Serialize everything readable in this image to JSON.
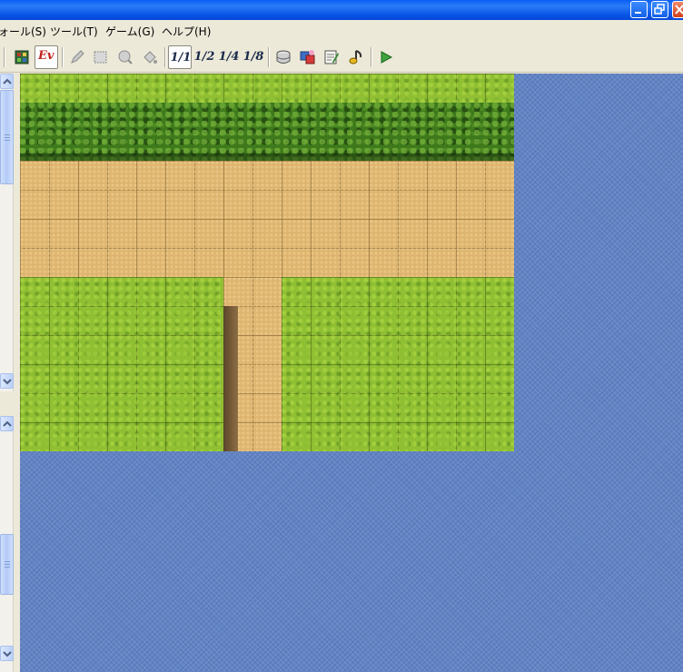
{
  "window": {
    "controls": {
      "minimize_icon": "minimize-icon",
      "maximize_icon": "restore-icon",
      "close_icon": "close-icon"
    }
  },
  "menu": {
    "items": [
      "ォール(S)",
      "ツール(T)",
      "ゲーム(G)",
      "ヘルプ(H)"
    ]
  },
  "toolbar": {
    "icons": [
      "tile-layer-icon",
      "event-layer-icon",
      "pencil-icon",
      "rectangle-icon",
      "ellipse-icon",
      "fill-icon"
    ],
    "event_label": "Ev",
    "scales": [
      "1/1",
      "1/2",
      "1/4",
      "1/8"
    ],
    "active_scale": "1/1",
    "tools": [
      "database-icon",
      "material-manager-icon",
      "script-editor-icon",
      "sound-test-icon",
      "playtest-icon"
    ]
  },
  "map": {
    "tiles": [
      "grass",
      "hedge",
      "dirt-path",
      "cliff"
    ],
    "colors": {
      "grass": "#8fbf32",
      "hedge": "#3e7a1c",
      "dirt": "#deb570",
      "void": "#6284c4"
    }
  }
}
